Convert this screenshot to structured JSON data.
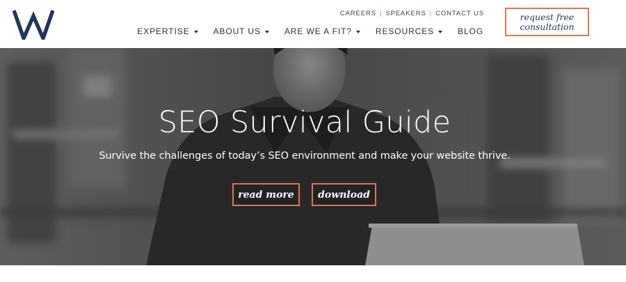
{
  "header": {
    "logo_text": "W",
    "utility_nav": [
      "CAREERS",
      "SPEAKERS",
      "CONTACT US"
    ],
    "main_nav": [
      {
        "label": "EXPERTISE",
        "has_dropdown": true
      },
      {
        "label": "ABOUT US",
        "has_dropdown": true
      },
      {
        "label": "ARE WE A FIT?",
        "has_dropdown": true
      },
      {
        "label": "RESOURCES",
        "has_dropdown": true
      },
      {
        "label": "BLOG",
        "has_dropdown": false
      }
    ],
    "cta_label": "request free consultation"
  },
  "hero": {
    "title": "SEO Survival Guide",
    "subtitle": "Survive the challenges of today’s SEO environment and make your website thrive.",
    "buttons": {
      "read_more": "read more",
      "download": "download"
    }
  },
  "colors": {
    "accent": "#e0774f",
    "brand_navy": "#22355e",
    "nav_text": "#2a2f3a"
  }
}
